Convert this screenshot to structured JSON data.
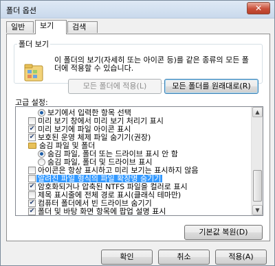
{
  "window": {
    "title": "폴더 옵션",
    "close_icon": "close-icon"
  },
  "tabs": [
    {
      "label": "일반",
      "active": false
    },
    {
      "label": "보기",
      "active": true
    },
    {
      "label": "검색",
      "active": false
    }
  ],
  "folder_views": {
    "legend": "폴더 보기",
    "icon": "folder-views-icon",
    "description": "이 폴더의 보기(자세히 또는 아이콘 등)를 같은 종류의 모든 폴더에 적용할 수 있습니다.",
    "apply_button": "모든 폴더에 적용(L)",
    "reset_button": "모든 폴더를 원래대로(R)"
  },
  "advanced": {
    "label": "고급 설정:",
    "items": [
      {
        "type": "radio",
        "checked": true,
        "indent": 1,
        "label": "보기에서 입력한 항목 선택"
      },
      {
        "type": "checkbox",
        "checked": false,
        "indent": 0,
        "label": "미리 보기 창에서 미리 보기 처리기 표시"
      },
      {
        "type": "checkbox",
        "checked": true,
        "indent": 0,
        "label": "미리 보기에 파일 아이콘 표시"
      },
      {
        "type": "checkbox",
        "checked": true,
        "indent": 0,
        "label": "보호된 운영 체제 파일 숨기기(권장)"
      },
      {
        "type": "folder",
        "indent": 0,
        "label": "숨김 파일 및 폴더"
      },
      {
        "type": "radio",
        "checked": true,
        "indent": 1,
        "label": "숨김 파일, 폴더 또는 드라이브 표시 안 함"
      },
      {
        "type": "radio",
        "checked": false,
        "indent": 1,
        "label": "숨김 파일, 폴더 및 드라이브 표시"
      },
      {
        "type": "checkbox",
        "checked": false,
        "indent": 0,
        "label": "아이콘은 항상 표시하고 미리 보기는 표시하지 않음"
      },
      {
        "type": "checkbox",
        "checked": false,
        "indent": 0,
        "label": "알려진 파일 형식의 파일 확장명 숨기기",
        "selected": true
      },
      {
        "type": "checkbox",
        "checked": true,
        "indent": 0,
        "label": "암호화되거나 압축된 NTFS 파일을 컬러로 표시"
      },
      {
        "type": "checkbox",
        "checked": false,
        "indent": 0,
        "label": "제목 표시줄에 전체 경로 표시(클래식 테마만)"
      },
      {
        "type": "checkbox",
        "checked": true,
        "indent": 0,
        "label": "컴퓨터 폴더에서 빈 드라이브 숨기기"
      },
      {
        "type": "checkbox",
        "checked": true,
        "indent": 0,
        "label": "폴더 및 바탕 화면 항목에 팝업 설명 표시"
      }
    ],
    "restore_button": "기본값 복원(D)"
  },
  "footer": {
    "ok": "확인",
    "cancel": "취소",
    "apply": "적용(A)"
  },
  "colors": {
    "selection": "#3399ff",
    "accent_border": "#3c7fb1"
  }
}
